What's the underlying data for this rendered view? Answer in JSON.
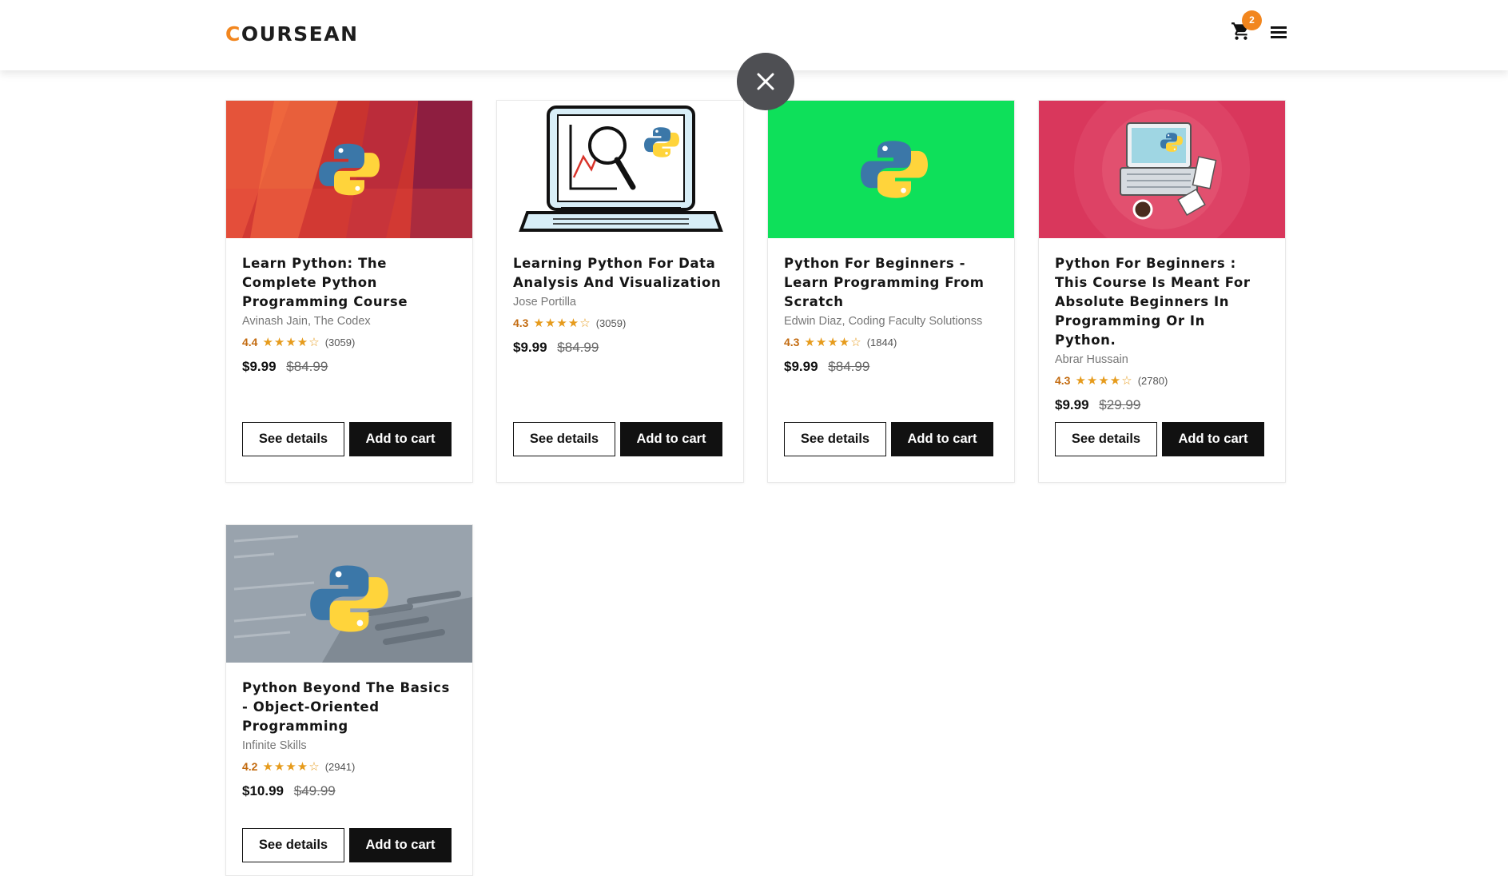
{
  "header": {
    "logo_first": "C",
    "logo_rest": "OURSEAN",
    "cart_icon": "cart-icon",
    "cart_count": "2",
    "menu_icon": "hamburger-menu-icon"
  },
  "overlay": {
    "close_icon": "close-icon"
  },
  "courses": [
    {
      "title": "Learn Python: The Complete Python Programming Course",
      "author": "Avinash Jain, The Codex",
      "rating": "4.4",
      "stars": "★★★★☆",
      "reviews": "(3059)",
      "price": "$9.99",
      "old_price": "$84.99",
      "details_label": "See details",
      "cart_label": "Add to cart",
      "thumb_bg": "#d33a2c"
    },
    {
      "title": "Learning Python For Data Analysis And Visualization",
      "author": "Jose Portilla",
      "rating": "4.3",
      "stars": "★★★★☆",
      "reviews": "(3059)",
      "price": "$9.99",
      "old_price": "$84.99",
      "details_label": "See details",
      "cart_label": "Add to cart",
      "thumb_bg": "#ffffff"
    },
    {
      "title": "Python For Beginners - Learn Programming From Scratch",
      "author": "Edwin Diaz, Coding Faculty Solutionss",
      "rating": "4.3",
      "stars": "★★★★☆",
      "reviews": "(1844)",
      "price": "$9.99",
      "old_price": "$84.99",
      "details_label": "See details",
      "cart_label": "Add to cart",
      "thumb_bg": "#0ee05a"
    },
    {
      "title": "Python For Beginners : This Course Is Meant For Absolute Beginners In Programming Or In Python.",
      "author": "Abrar Hussain",
      "rating": "4.3",
      "stars": "★★★★☆",
      "reviews": "(2780)",
      "price": "$9.99",
      "old_price": "$29.99",
      "details_label": "See details",
      "cart_label": "Add to cart",
      "thumb_bg": "#d9375c"
    },
    {
      "title": "Python Beyond The Basics - Object-Oriented Programming",
      "author": "Infinite Skills",
      "rating": "4.2",
      "stars": "★★★★☆",
      "reviews": "(2941)",
      "price": "$10.99",
      "old_price": "$49.99",
      "details_label": "See details",
      "cart_label": "Add to cart",
      "thumb_bg": "#8c969f"
    }
  ]
}
